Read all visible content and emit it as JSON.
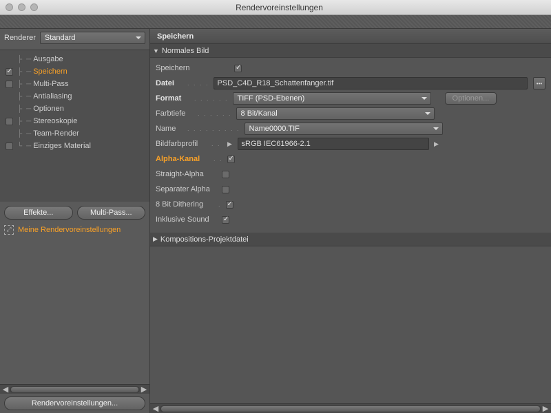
{
  "window": {
    "title": "Rendervoreinstellungen"
  },
  "sidebar": {
    "renderer_label": "Renderer",
    "renderer_value": "Standard",
    "items": [
      {
        "label": "Ausgabe",
        "checked": null
      },
      {
        "label": "Speichern",
        "checked": true,
        "active": true
      },
      {
        "label": "Multi-Pass",
        "checked": false
      },
      {
        "label": "Antialiasing",
        "checked": null
      },
      {
        "label": "Optionen",
        "checked": null
      },
      {
        "label": "Stereoskopie",
        "checked": false
      },
      {
        "label": "Team-Render",
        "checked": null
      },
      {
        "label": "Einziges Material",
        "checked": false
      }
    ],
    "buttons": {
      "effects": "Effekte...",
      "multipass": "Multi-Pass..."
    },
    "preset": "Meine Rendervoreinstellungen",
    "footer_btn": "Rendervoreinstellungen..."
  },
  "panel": {
    "title": "Speichern",
    "section1": {
      "title": "Normales Bild",
      "save_label": "Speichern",
      "save_checked": true,
      "file_label": "Datei",
      "file_value": "PSD_C4D_R18_Schattenfanger.tif",
      "format_label": "Format",
      "format_value": "TIFF (PSD-Ebenen)",
      "options_btn": "Optionen...",
      "depth_label": "Farbtiefe",
      "depth_value": "8 Bit/Kanal",
      "name_label": "Name",
      "name_value": "Name0000.TIF",
      "profile_label": "Bildfarbprofil",
      "profile_value": "sRGB IEC61966-2.1",
      "alpha_label": "Alpha-Kanal",
      "alpha_checked": true,
      "straight_label": "Straight-Alpha",
      "straight_checked": false,
      "seperate_label": "Separater Alpha",
      "seperate_checked": false,
      "dither_label": "8 Bit Dithering",
      "dither_checked": true,
      "sound_label": "Inklusive Sound",
      "sound_checked": true
    },
    "section2": {
      "title": "Kompositions-Projektdatei"
    }
  }
}
